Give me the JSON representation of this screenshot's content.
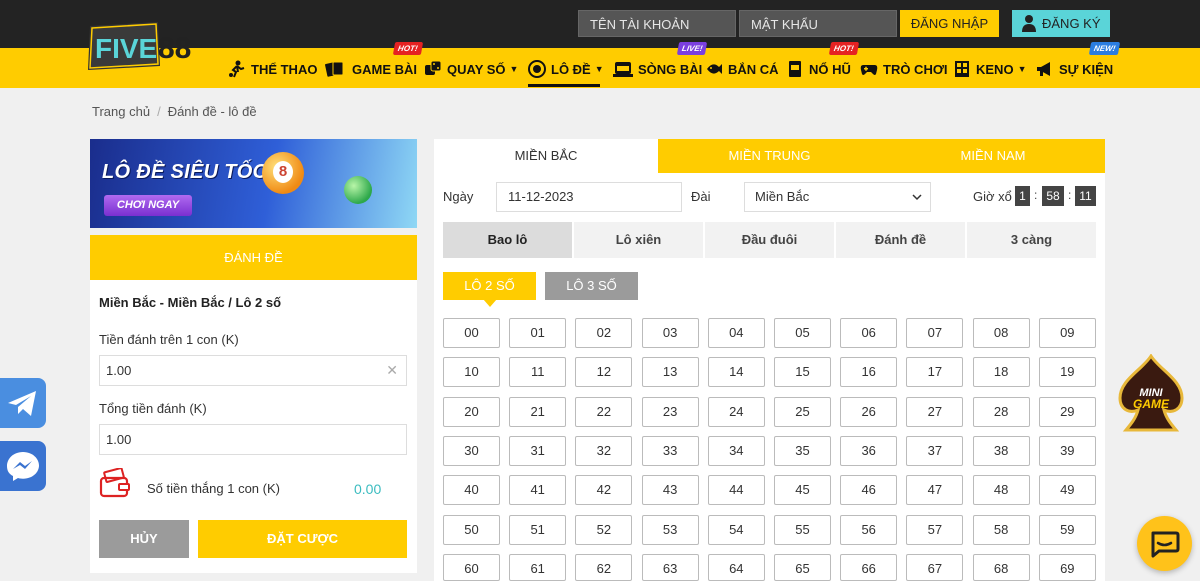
{
  "topbar": {
    "username_placeholder": "TÊN TÀI KHOẢN",
    "password_placeholder": "MẬT KHẨU",
    "login_label": "ĐĂNG NHẬP",
    "register_label": "ĐĂNG KÝ"
  },
  "brand": {
    "logo_text_five": "FIVE",
    "logo_text_88": "88",
    "accent": "#ffcc00",
    "dark": "#232323"
  },
  "nav": {
    "items": [
      {
        "label": "THỂ THAO",
        "icon": "soccer-player-icon"
      },
      {
        "label": "GAME BÀI",
        "icon": "playing-cards-icon",
        "badge": "HOT!"
      },
      {
        "label": "QUAY SỐ",
        "icon": "dice-icon",
        "dropdown": true
      },
      {
        "label": "LÔ ĐỀ",
        "icon": "lottery-ball-icon",
        "dropdown": true,
        "active": true
      },
      {
        "label": "SÒNG BÀI",
        "icon": "casino-icon",
        "badge": "LIVE!"
      },
      {
        "label": "BẮN CÁ",
        "icon": "fish-icon"
      },
      {
        "label": "NỔ HŨ",
        "icon": "slot-machine-icon",
        "badge": "HOT!"
      },
      {
        "label": "TRÒ CHƠI",
        "icon": "gamepad-icon"
      },
      {
        "label": "KENO",
        "icon": "keno-grid-icon",
        "dropdown": true
      },
      {
        "label": "SỰ KIỆN",
        "icon": "megaphone-icon",
        "badge": "NEW!"
      }
    ]
  },
  "breadcrumb": {
    "home": "Trang chủ",
    "current": "Đánh đề - lô đề"
  },
  "banner": {
    "title": "LÔ ĐỀ SIÊU TỐC",
    "cta": "CHƠI NGAY",
    "ball_number": "8"
  },
  "bet_panel": {
    "header": "ĐÁNH ĐỀ",
    "subtitle": "Miền Bắc - Miền Bắc / Lô 2 số",
    "stake_label": "Tiền đánh trên 1 con (K)",
    "stake_value": "1.00",
    "total_label": "Tổng tiền đánh (K)",
    "total_value": "1.00",
    "win_label": "Số tiền thắng 1 con (K)",
    "win_value": "0.00",
    "cancel_label": "HỦY",
    "submit_label": "ĐẶT CƯỢC"
  },
  "regions": [
    "MIỀN BẮC",
    "MIỀN TRUNG",
    "MIỀN NAM"
  ],
  "filters": {
    "date_label": "Ngày",
    "date_value": "11-12-2023",
    "station_label": "Đài",
    "station_value": "Miền Bắc",
    "draw_time_label": "Giờ xổ",
    "draw_time": [
      "1",
      "58",
      "11"
    ]
  },
  "bet_types": [
    "Bao lô",
    "Lô xiên",
    "Đầu đuôi",
    "Đánh đề",
    "3 càng"
  ],
  "modes": [
    "LÔ 2 SỐ",
    "LÔ 3 SỐ"
  ],
  "numbers": [
    "00",
    "01",
    "02",
    "03",
    "04",
    "05",
    "06",
    "07",
    "08",
    "09",
    "10",
    "11",
    "12",
    "13",
    "14",
    "15",
    "16",
    "17",
    "18",
    "19",
    "20",
    "21",
    "22",
    "23",
    "24",
    "25",
    "26",
    "27",
    "28",
    "29",
    "30",
    "31",
    "32",
    "33",
    "34",
    "35",
    "36",
    "37",
    "38",
    "39",
    "40",
    "41",
    "42",
    "43",
    "44",
    "45",
    "46",
    "47",
    "48",
    "49",
    "50",
    "51",
    "52",
    "53",
    "54",
    "55",
    "56",
    "57",
    "58",
    "59",
    "60",
    "61",
    "62",
    "63",
    "64",
    "65",
    "66",
    "67",
    "68",
    "69"
  ],
  "floating": {
    "mini_game_top": "MINI",
    "mini_game_bottom": "GAME"
  }
}
